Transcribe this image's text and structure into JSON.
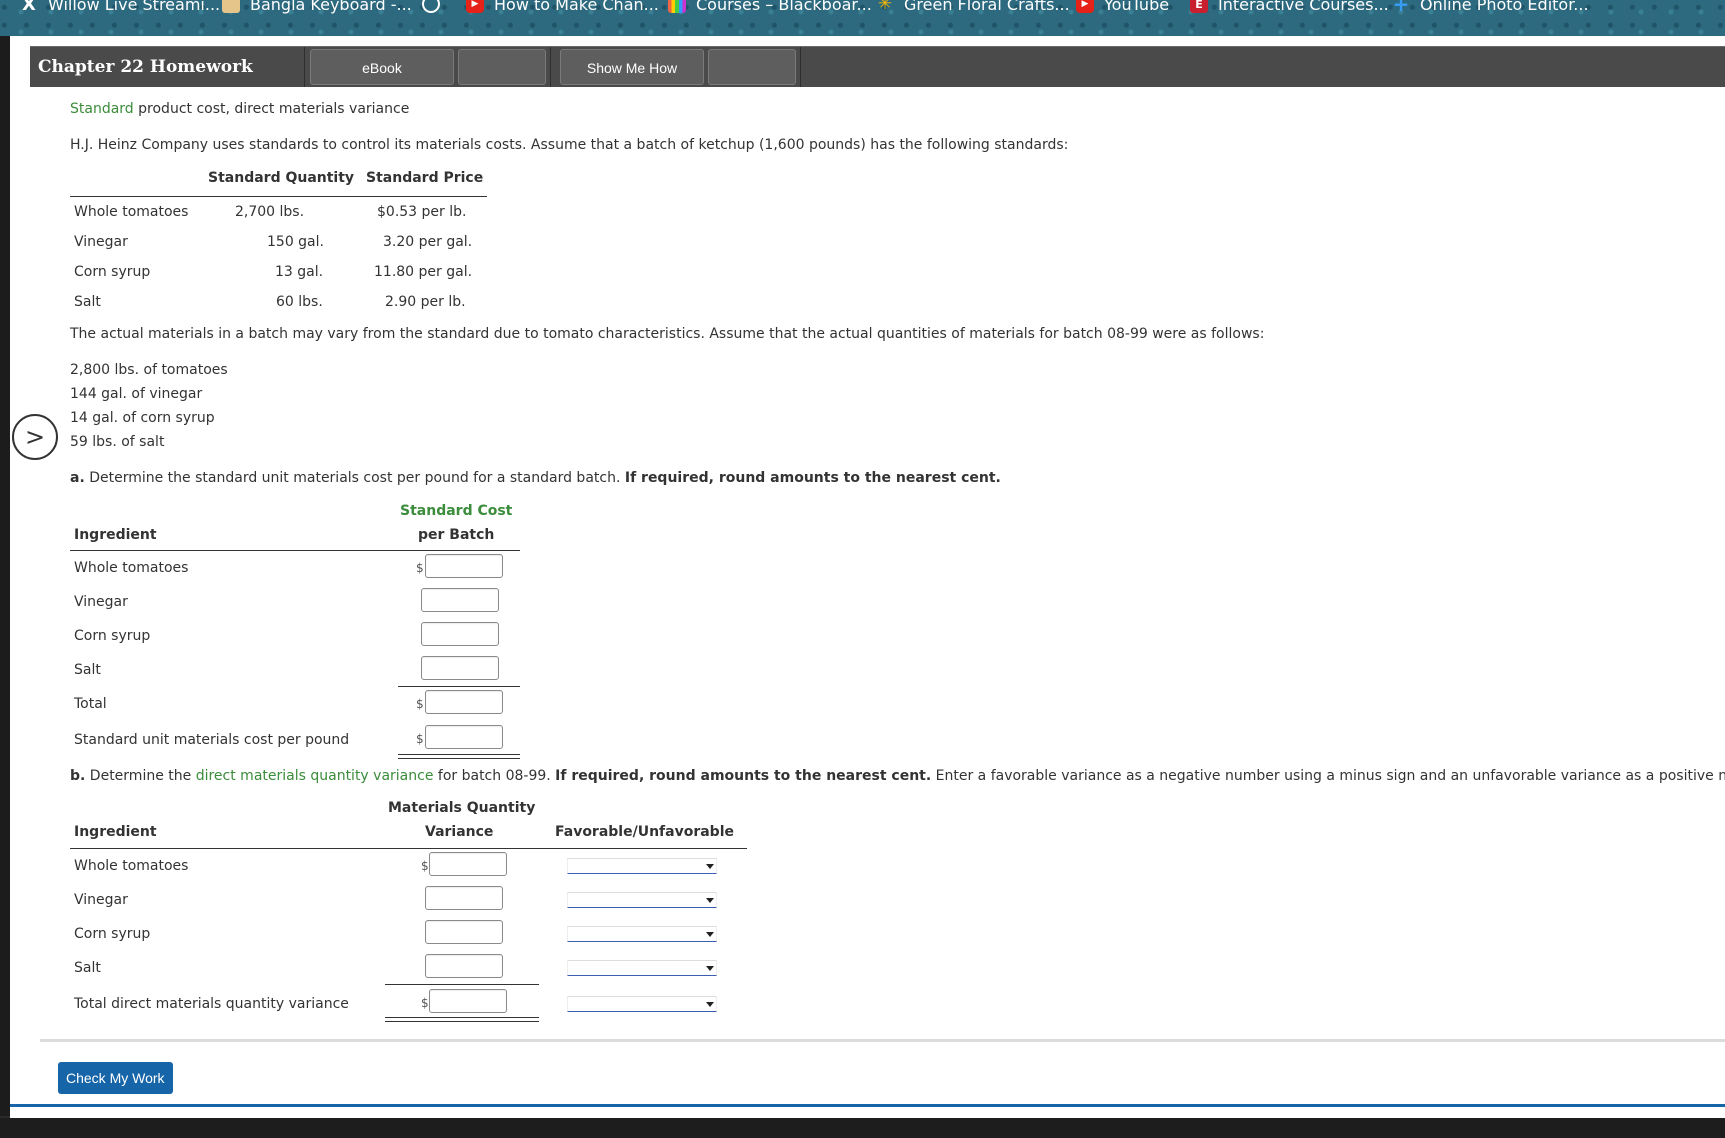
{
  "bookmarks": [
    {
      "label": "Willow Live Streami...",
      "icon": "x-icon"
    },
    {
      "label": "Bangla Keyboard -...",
      "icon": "leaf-icon"
    },
    {
      "label": "",
      "icon": "globe-icon"
    },
    {
      "label": "How to Make Chan...",
      "icon": "youtube-icon"
    },
    {
      "label": "Courses – Blackboar...",
      "icon": "bars-icon"
    },
    {
      "label": "Green Floral Crafts...",
      "icon": "walmart-star-icon"
    },
    {
      "label": "YouTube",
      "icon": "youtube-icon"
    },
    {
      "label": "Interactive Courses...",
      "icon": "ec-icon"
    },
    {
      "label": "Online Photo Editor...",
      "icon": "plus-icon"
    }
  ],
  "header": {
    "title": "Chapter 22 Homework",
    "ebook_label": "eBook",
    "show_me_how_label": "Show Me How"
  },
  "problem": {
    "heading_link": "Standard",
    "heading_rest": " product cost, direct materials variance",
    "intro": "H.J. Heinz Company uses standards to control its materials costs. Assume that a batch of ketchup (1,600 pounds) has the following standards:",
    "std_table": {
      "col_qty": "Standard Quantity",
      "col_price": "Standard Price",
      "rows": [
        {
          "name": "Whole tomatoes",
          "qty": "2,700 lbs.",
          "price": "$0.53 per lb."
        },
        {
          "name": "Vinegar",
          "qty": "150 gal.",
          "price": "3.20 per gal."
        },
        {
          "name": "Corn syrup",
          "qty": "13 gal.",
          "price": "11.80 per gal."
        },
        {
          "name": "Salt",
          "qty": "60 lbs.",
          "price": "2.90 per lb."
        }
      ]
    },
    "actual_intro": "The actual materials in a batch may vary from the standard due to tomato characteristics. Assume that the actual quantities of materials for batch 08-99 were as follows:",
    "actuals": [
      "2,800 lbs. of tomatoes",
      "144 gal. of vinegar",
      "14 gal. of corn syrup",
      "59 lbs. of salt"
    ]
  },
  "part_a": {
    "letter": "a.",
    "text": " Determine the standard unit materials cost per pound for a standard batch. ",
    "bold": "If required, round amounts to the nearest cent.",
    "col_ingredient": "Ingredient",
    "col_cost_line1": "Standard Cost",
    "col_cost_line2": "per Batch",
    "rows": [
      "Whole tomatoes",
      "Vinegar",
      "Corn syrup",
      "Salt",
      "Total",
      "Standard unit materials cost per pound"
    ],
    "currency": "$"
  },
  "part_b": {
    "letter": "b.",
    "text_pre": " Determine the ",
    "link": "direct materials quantity variance",
    "text_post": " for batch 08-99. ",
    "bold": "If required, round amounts to the nearest cent.",
    "text_end": " Enter a favorable variance as a negative number using a minus sign and an unfavorable variance as a positive number.",
    "col_ingredient": "Ingredient",
    "col_var_line1": "Materials Quantity",
    "col_var_line2": "Variance",
    "col_fav": "Favorable/Unfavorable",
    "rows": [
      "Whole tomatoes",
      "Vinegar",
      "Corn syrup",
      "Salt",
      "Total direct materials quantity variance"
    ],
    "currency": "$"
  },
  "check_button": "Check My Work",
  "colors": {
    "accent_green": "#3b8c3b",
    "button_blue": "#1565a8"
  }
}
